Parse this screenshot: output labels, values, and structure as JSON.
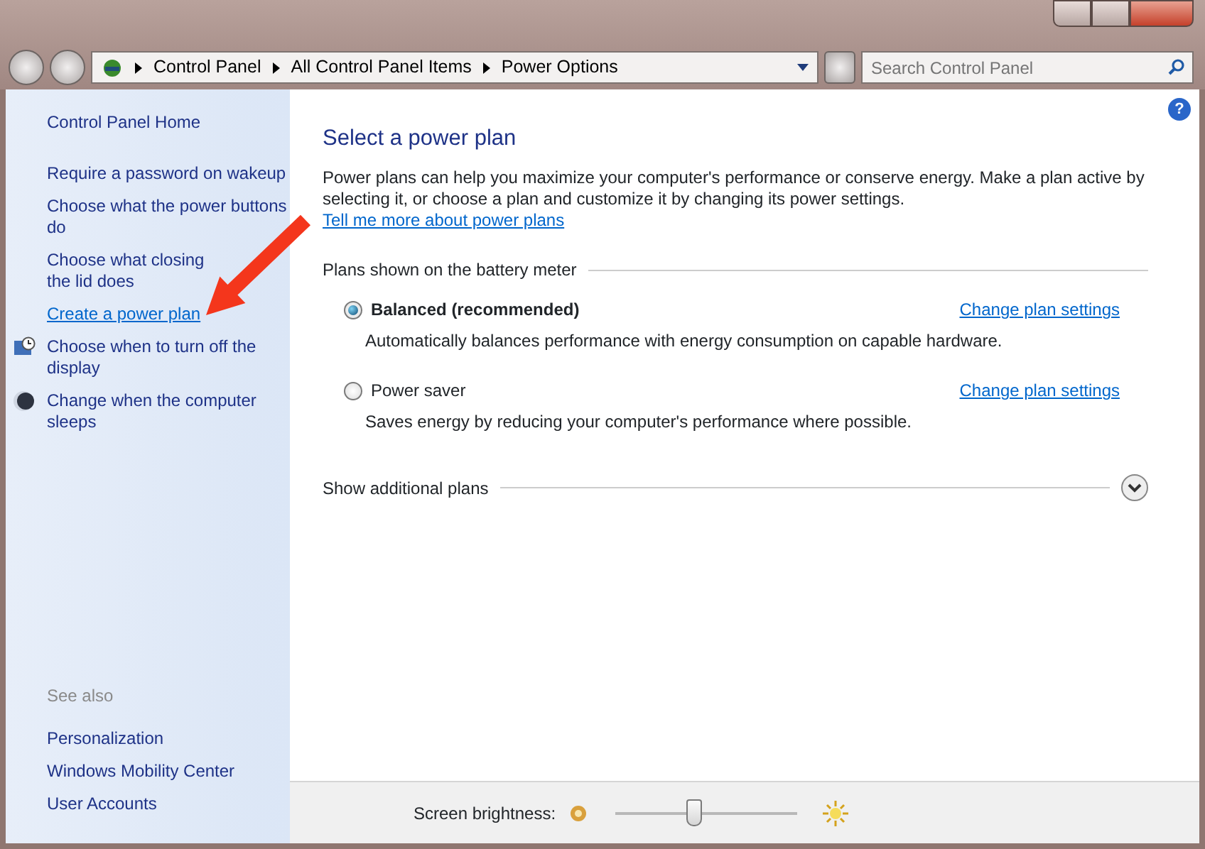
{
  "address_bar": {
    "crumbs": [
      "Control Panel",
      "All Control Panel Items",
      "Power Options"
    ],
    "search_placeholder": "Search Control Panel"
  },
  "sidebar": {
    "home": "Control Panel Home",
    "tasks": [
      {
        "label": "Require a password on wakeup",
        "kind": "plain",
        "selected": false
      },
      {
        "label": "Choose what the power buttons do",
        "kind": "plain",
        "selected": false
      },
      {
        "label": "Choose what closing the lid does",
        "kind": "plain",
        "selected": false
      },
      {
        "label": "Create a power plan",
        "kind": "plain",
        "selected": true
      },
      {
        "label": "Choose when to turn off the display",
        "kind": "display",
        "selected": false
      },
      {
        "label": "Change when the computer sleeps",
        "kind": "sleep",
        "selected": false
      }
    ],
    "see_also_title": "See also",
    "see_also": [
      "Personalization",
      "Windows Mobility Center",
      "User Accounts"
    ]
  },
  "main": {
    "title": "Select a power plan",
    "intro": "Power plans can help you maximize your computer's performance or conserve energy. Make a plan active by selecting it, or choose a plan and customize it by changing its power settings.",
    "intro_link": "Tell me more about power plans",
    "group_title": "Plans shown on the battery meter",
    "plans": [
      {
        "name": "Balanced (recommended)",
        "selected": true,
        "description": "Automatically balances performance with energy consumption on capable hardware.",
        "link": "Change plan settings"
      },
      {
        "name": "Power saver",
        "selected": false,
        "description": "Saves energy by reducing your computer's performance where possible.",
        "link": "Change plan settings"
      }
    ],
    "more_plans": "Show additional plans"
  },
  "help_button": "?",
  "brightness": {
    "label": "Screen brightness:",
    "level": 0.43
  }
}
